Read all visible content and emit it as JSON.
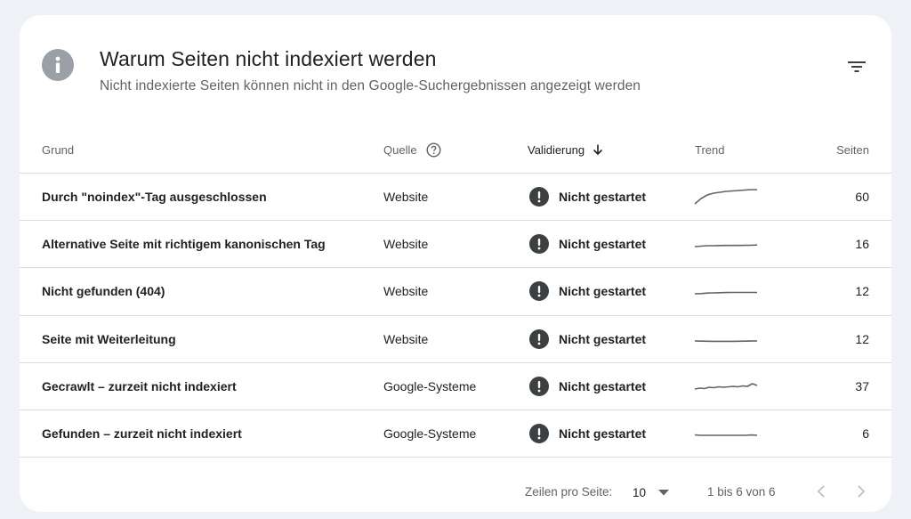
{
  "header": {
    "title": "Warum Seiten nicht indexiert werden",
    "subtitle": "Nicht indexierte Seiten können nicht in den Google-Suchergebnissen angezeigt werden",
    "icon": "info-icon",
    "filter_icon": "filter-icon"
  },
  "columns": {
    "grund": "Grund",
    "quelle": "Quelle",
    "validierung": "Validierung",
    "trend": "Trend",
    "seiten": "Seiten"
  },
  "rows": [
    {
      "grund": "Durch \"noindex\"-Tag ausgeschlossen",
      "quelle": "Website",
      "validierung": "Nicht gestartet",
      "seiten": "60",
      "trend": [
        2,
        8,
        12,
        14,
        15,
        16,
        16.5,
        17,
        17.5,
        18,
        18
      ]
    },
    {
      "grund": "Alternative Seite mit richtigem kanonischen Tag",
      "quelle": "Website",
      "validierung": "Nicht gestartet",
      "seiten": "16",
      "trend": [
        7,
        7.5,
        8,
        8,
        8.2,
        8.3,
        8.3,
        8.3,
        8.4,
        8.5,
        8.8
      ]
    },
    {
      "grund": "Nicht gefunden (404)",
      "quelle": "Website",
      "validierung": "Nicht gestartet",
      "seiten": "12",
      "trend": [
        7,
        7.2,
        7.8,
        8,
        8.2,
        8.4,
        8.5,
        8.5,
        8.5,
        8.5,
        8.5
      ]
    },
    {
      "grund": "Seite mit Weiterleitung",
      "quelle": "Website",
      "validierung": "Nicht gestartet",
      "seiten": "12",
      "trend": [
        8,
        7.8,
        7.7,
        7.6,
        7.6,
        7.6,
        7.6,
        7.7,
        7.8,
        7.9,
        8
      ]
    },
    {
      "grund": "Gecrawlt – zurzeit nicht indexiert",
      "quelle": "Google-Systeme",
      "validierung": "Nicht gestartet",
      "seiten": "37",
      "trend": [
        7,
        8,
        7.5,
        9,
        8.5,
        9.5,
        9,
        9.5,
        10,
        9.5,
        10.5,
        10,
        13,
        11
      ]
    },
    {
      "grund": "Gefunden – zurzeit nicht indexiert",
      "quelle": "Google-Systeme",
      "validierung": "Nicht gestartet",
      "seiten": "6",
      "trend": [
        8.5,
        8,
        8,
        8,
        8,
        8,
        8,
        8,
        8,
        8,
        8.4,
        8
      ]
    }
  ],
  "footer": {
    "rows_label": "Zeilen pro Seite:",
    "rows_value": "10",
    "range": "1 bis 6 von 6"
  },
  "colors": {
    "accent_icon": "#3c4043",
    "trend_line": "#5f6368"
  }
}
